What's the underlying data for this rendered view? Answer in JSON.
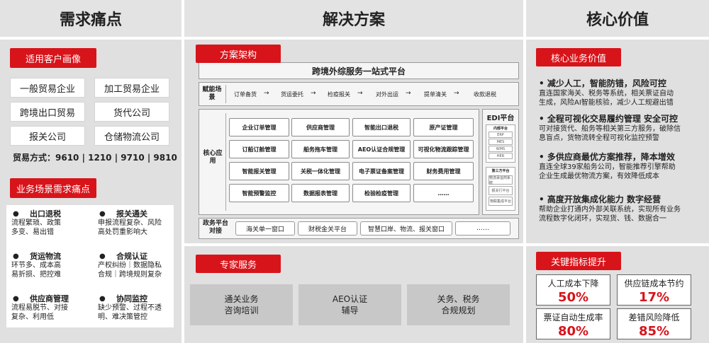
{
  "headers": {
    "pain": "需求痛点",
    "solution": "解决方案",
    "value": "核心价值"
  },
  "customer": {
    "tag": "适用客户画像",
    "items": [
      "一般贸易企业",
      "加工贸易企业",
      "跨境出口贸易",
      "货代公司",
      "报关公司",
      "仓储物流公司"
    ],
    "trade": "贸易方式：9610 | 1210 | 9710 | 9810"
  },
  "scene": {
    "tag": "业务场景需求痛点",
    "items": [
      {
        "title": "出口退税",
        "lines": [
          "流程繁琐、政策",
          "多变、易出错"
        ]
      },
      {
        "title": "报关通关",
        "lines": [
          "申报流程复杂、风险",
          "高处罚重影响大"
        ]
      },
      {
        "title": "货运物流",
        "lines": [
          "环节多、成本高",
          "易折损、把控难"
        ]
      },
      {
        "title": "合规认证",
        "lines": [
          "产权纠纷｜数据隐私",
          "合规｜跨境规则复杂"
        ]
      },
      {
        "title": "供应商管理",
        "lines": [
          "流程易脱节、对接",
          "复杂、利用低"
        ]
      },
      {
        "title": "协同监控",
        "lines": [
          "缺少预警、过程不透",
          "明、难决策管控"
        ]
      }
    ]
  },
  "arch": {
    "tag": "方案架构",
    "platform": "跨境外综服务一站式平台",
    "enable_label": "赋能场景",
    "flow": [
      "订单备货",
      "货运委托",
      "检疫报关",
      "对外出运",
      "提单清关",
      "收款退税"
    ],
    "core_label": "核心应用",
    "apps": [
      [
        "企业订单管理",
        "供应商管理",
        "智能出口退税",
        "原产证管理"
      ],
      [
        "订船订舱管理",
        "船务拖车管理",
        "AEO认证合规管理",
        "可视化物流跟踪管理"
      ],
      [
        "智能报关管理",
        "关税一体化管理",
        "电子票证备案管理",
        "财务费用管理"
      ],
      [
        "智能预警监控",
        "数据报表管理",
        "检验检疫管理",
        "……"
      ]
    ],
    "edi": {
      "title": "EDI平台",
      "inner_title": "内部平台",
      "inner": [
        "ERP",
        "MES",
        "WMS",
        "HER"
      ],
      "third_title": "第三方平台",
      "third": [
        "物流承运商系统",
        "报关行平台",
        "物联集成平台"
      ]
    },
    "gov_label": "政务平台对接",
    "gov": [
      "海关单一窗口",
      "财税金关平台",
      "智慧口岸、物流、报关窗口",
      "……"
    ]
  },
  "expert": {
    "tag": "专家服务",
    "items": [
      [
        "通关业务",
        "咨询培训"
      ],
      [
        "AEO认证",
        "辅导"
      ],
      [
        "关务、税务",
        "合规规划"
      ]
    ]
  },
  "value": {
    "tag": "核心业务价值",
    "items": [
      {
        "title": "•  减少人工，智能防错，风险可控",
        "lines": [
          "直连国家海关、税务等系统，相关票证自动",
          "生成，风险AI智能核验，减少人工规避出错"
        ]
      },
      {
        "title": "•  全程可视化交易履约管理 安全可控",
        "lines": [
          "可对接货代、船务等相关第三方服务，破除信",
          "息盲点，货物流转全程可视化监控预警"
        ]
      },
      {
        "title": "•  多供应商最优方案推荐，降本增效",
        "lines": [
          "直连全球39家船务公司，智能推荐引擎帮助",
          "企业生成最优物流方案，有效降低成本"
        ]
      },
      {
        "title": "•  高度开放集成化能力 数字经营",
        "lines": [
          "帮助企业打通内外部关联系统，实现所有业务",
          "流程数字化闭环，实现货、钱、数据合一"
        ]
      }
    ]
  },
  "kpi": {
    "tag": "关键指标提升",
    "items": [
      {
        "label": "人工成本下降",
        "value": "50%"
      },
      {
        "label": "供应链成本节约",
        "value": "17%"
      },
      {
        "label": "票证自动生成率",
        "value": "80%"
      },
      {
        "label": "差错风险降低",
        "value": "85%"
      }
    ]
  }
}
